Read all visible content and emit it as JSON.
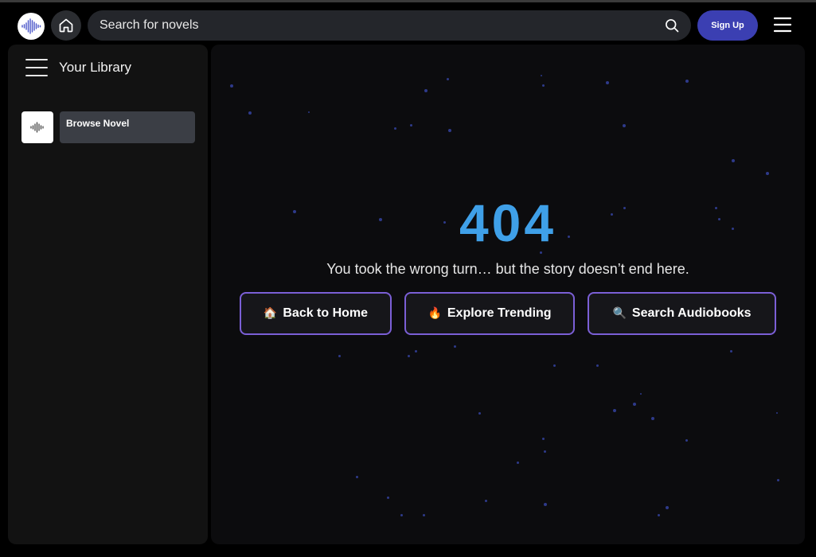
{
  "header": {
    "search_placeholder": "Search for novels",
    "signup_label": "Sign Up",
    "logo_icon": "audio-wave-logo-icon",
    "home_icon": "home-icon",
    "search_icon": "search-icon",
    "menu_icon": "hamburger-menu-icon",
    "brand_color": "#3b3fb2"
  },
  "sidebar": {
    "library_title": "Your Library",
    "items": [
      {
        "label": "Browse Novel",
        "icon": "audio-wave-icon"
      }
    ]
  },
  "error_page": {
    "code": "404",
    "message": "You took the wrong turn… but the story doesn’t end here.",
    "code_color": "#3fa0e8",
    "button_border_color": "#7b5fd6",
    "buttons": [
      {
        "emoji": "🏠",
        "label": "Back to Home",
        "icon": "house-icon"
      },
      {
        "emoji": "🔥",
        "label": "Explore Trending",
        "icon": "fire-icon"
      },
      {
        "emoji": "🔍",
        "label": "Search Audiobooks",
        "icon": "magnifier-icon"
      }
    ]
  }
}
